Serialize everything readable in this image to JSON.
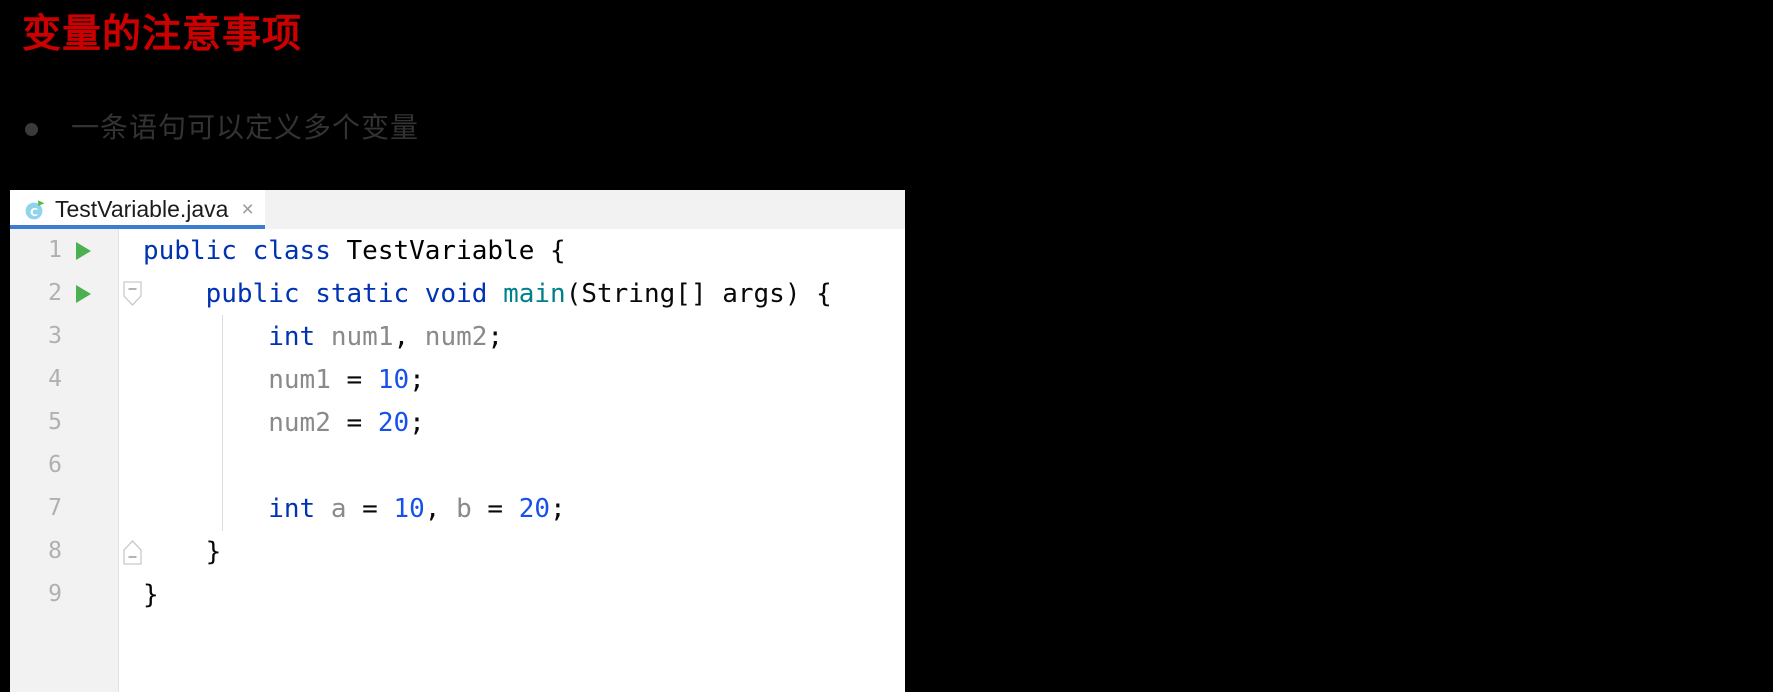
{
  "slide": {
    "title": "变量的注意事项",
    "bullets": [
      {
        "marker": "filled-circle",
        "text": "一条语句可以定义多个变量"
      }
    ],
    "background_color": "#000000",
    "title_color": "#CC0000",
    "bullet_text_color": "#333333"
  },
  "editor": {
    "tab": {
      "label": "TestVariable.java",
      "icon": "java-class-runnable-icon",
      "close_label": "×",
      "active_underline_color": "#3a7dd1"
    },
    "gutter": {
      "line_numbers": [
        "1",
        "2",
        "3",
        "4",
        "5",
        "6",
        "7",
        "8",
        "9"
      ],
      "run_markers_on_lines": [
        "1",
        "2"
      ],
      "fold_markers_on_lines": [
        "2",
        "8"
      ]
    },
    "code_lines": [
      {
        "number": "1",
        "tokens": [
          {
            "text": "public",
            "kind": "keyword"
          },
          {
            "text": " ",
            "kind": "plain"
          },
          {
            "text": "class",
            "kind": "keyword"
          },
          {
            "text": " ",
            "kind": "plain"
          },
          {
            "text": "TestVariable",
            "kind": "class"
          },
          {
            "text": " {",
            "kind": "plain"
          }
        ]
      },
      {
        "number": "2",
        "tokens": [
          {
            "text": "    ",
            "kind": "plain"
          },
          {
            "text": "public",
            "kind": "keyword"
          },
          {
            "text": " ",
            "kind": "plain"
          },
          {
            "text": "static",
            "kind": "keyword"
          },
          {
            "text": " ",
            "kind": "plain"
          },
          {
            "text": "void",
            "kind": "keyword"
          },
          {
            "text": " ",
            "kind": "plain"
          },
          {
            "text": "main",
            "kind": "method"
          },
          {
            "text": "(String[] args) {",
            "kind": "plain"
          }
        ]
      },
      {
        "number": "3",
        "tokens": [
          {
            "text": "        ",
            "kind": "plain"
          },
          {
            "text": "int",
            "kind": "keyword"
          },
          {
            "text": " ",
            "kind": "plain"
          },
          {
            "text": "num1",
            "kind": "variable"
          },
          {
            "text": ", ",
            "kind": "plain"
          },
          {
            "text": "num2",
            "kind": "variable"
          },
          {
            "text": ";",
            "kind": "plain"
          }
        ]
      },
      {
        "number": "4",
        "tokens": [
          {
            "text": "        ",
            "kind": "plain"
          },
          {
            "text": "num1",
            "kind": "variable"
          },
          {
            "text": " = ",
            "kind": "plain"
          },
          {
            "text": "10",
            "kind": "number"
          },
          {
            "text": ";",
            "kind": "plain"
          }
        ]
      },
      {
        "number": "5",
        "tokens": [
          {
            "text": "        ",
            "kind": "plain"
          },
          {
            "text": "num2",
            "kind": "variable"
          },
          {
            "text": " = ",
            "kind": "plain"
          },
          {
            "text": "20",
            "kind": "number"
          },
          {
            "text": ";",
            "kind": "plain"
          }
        ]
      },
      {
        "number": "6",
        "tokens": []
      },
      {
        "number": "7",
        "tokens": [
          {
            "text": "        ",
            "kind": "plain"
          },
          {
            "text": "int",
            "kind": "keyword"
          },
          {
            "text": " ",
            "kind": "plain"
          },
          {
            "text": "a",
            "kind": "variable"
          },
          {
            "text": " = ",
            "kind": "plain"
          },
          {
            "text": "10",
            "kind": "number"
          },
          {
            "text": ", ",
            "kind": "plain"
          },
          {
            "text": "b",
            "kind": "variable"
          },
          {
            "text": " = ",
            "kind": "plain"
          },
          {
            "text": "20",
            "kind": "number"
          },
          {
            "text": ";",
            "kind": "plain"
          }
        ]
      },
      {
        "number": "8",
        "tokens": [
          {
            "text": "    }",
            "kind": "plain"
          }
        ]
      },
      {
        "number": "9",
        "tokens": [
          {
            "text": "}",
            "kind": "plain"
          }
        ]
      }
    ]
  }
}
